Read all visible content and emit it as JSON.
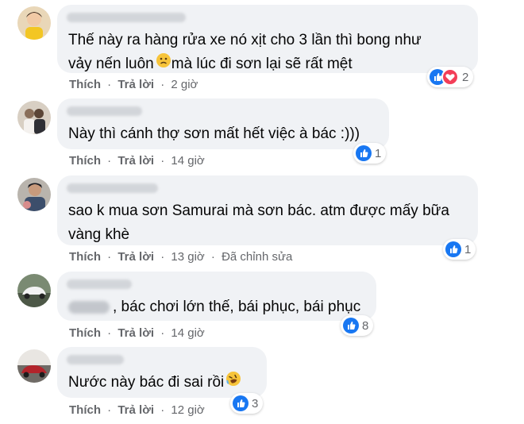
{
  "actions": {
    "like": "Thích",
    "reply": "Trả lời",
    "separator": "·"
  },
  "comments": [
    {
      "text_lines": [
        "Thế này ra hàng rửa xe nó xịt cho 3 lần thì bong như",
        "vảy nến luôn",
        "mà lúc đi sơn lại sẽ rất mệt"
      ],
      "inline_emoji": "sad-face",
      "time": "2 giờ",
      "edited": "",
      "reaction_icons": [
        "like-icon",
        "love-icon"
      ],
      "reaction_count": "2"
    },
    {
      "text_lines": [
        "Này thì cánh thợ sơn mất hết việc à bác :)))"
      ],
      "time": "14 giờ",
      "edited": "",
      "reaction_icons": [
        "like-icon"
      ],
      "reaction_count": "1"
    },
    {
      "text_lines": [
        "sao k mua sơn Samurai mà sơn bác. atm được mấy bữa",
        "vàng khè"
      ],
      "time": "13 giờ",
      "edited": "Đã chỉnh sửa",
      "reaction_icons": [
        "like-icon"
      ],
      "reaction_count": "1"
    },
    {
      "text_lines": [
        ", bác chơi lớn thế, bái phục, bái phục"
      ],
      "time": "14 giờ",
      "edited": "",
      "reaction_icons": [
        "like-icon"
      ],
      "reaction_count": "8"
    },
    {
      "text_lines": [
        "Nước này bác đi sai rồi"
      ],
      "inline_emoji": "rofl-face",
      "time": "12 giờ",
      "edited": "",
      "reaction_icons": [
        "like-icon"
      ],
      "reaction_count": "3"
    }
  ],
  "colors": {
    "like": "#1877f2",
    "love": "#f33e58",
    "bubble": "#f0f2f5",
    "meta": "#65676b"
  }
}
